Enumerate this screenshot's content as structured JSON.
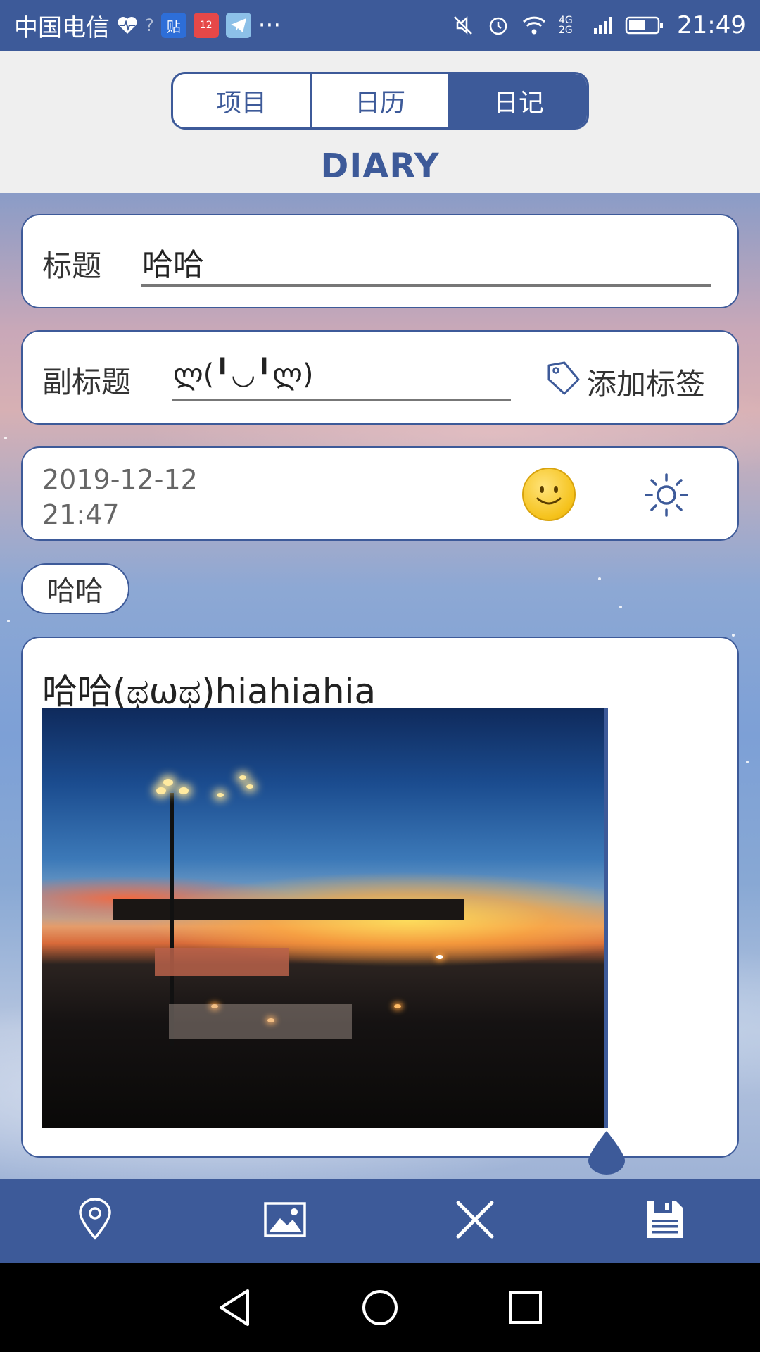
{
  "status_bar": {
    "carrier": "中国电信",
    "time": "21:49",
    "network": "4G 2G",
    "icons": [
      "heart-monitor-icon",
      "wifi-question-icon",
      "tieba-app-icon",
      "shopping-app-icon",
      "telegram-app-icon",
      "more-icon",
      "mute-icon",
      "alarm-icon",
      "wifi-icon",
      "signal-icon",
      "battery-icon"
    ],
    "more": "···"
  },
  "tabs": [
    {
      "label": "项目",
      "active": false
    },
    {
      "label": "日历",
      "active": false
    },
    {
      "label": "日记",
      "active": true
    }
  ],
  "page_title": "DIARY",
  "title_field": {
    "label": "标题",
    "value": "哈哈"
  },
  "subtitle_field": {
    "label": "副标题",
    "value": "ლ(╹◡╹ლ)"
  },
  "add_tag": {
    "label": "添加标签",
    "icon": "tag-icon"
  },
  "entry": {
    "date": "2019-12-12",
    "time": "21:47",
    "mood_icon": "smiley-face-icon",
    "weather_icon": "sun-icon"
  },
  "tag_chip": "哈哈",
  "body_text": "哈哈(ಥωಥ)hiahiahia",
  "toolbar": [
    "location-pin-icon",
    "image-icon",
    "close-icon",
    "save-icon"
  ],
  "navbar": [
    "back-icon",
    "home-icon",
    "recents-icon"
  ],
  "colors": {
    "accent": "#3d5a99",
    "header_bg": "#efefef",
    "card_bg": "#ffffff"
  }
}
